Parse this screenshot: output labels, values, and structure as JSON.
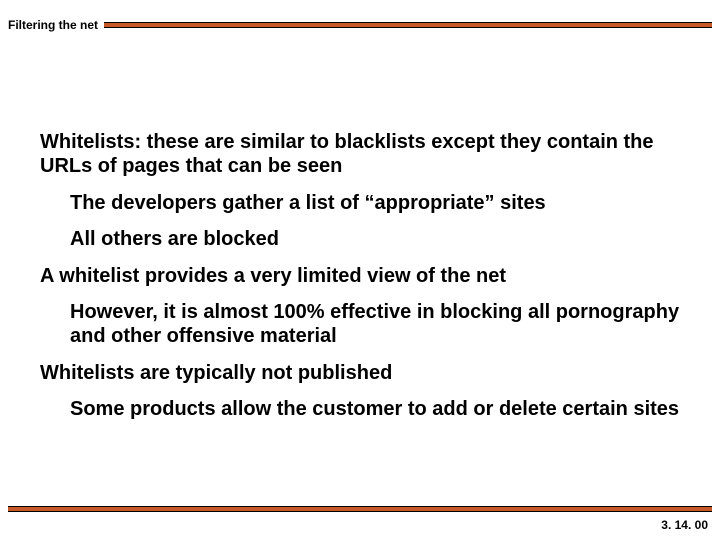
{
  "header": {
    "title": "Filtering the net"
  },
  "body": {
    "p1": "Whitelists: these are similar to blacklists except they contain the URLs of pages that can be seen",
    "p2": "The developers gather a list of “appropriate” sites",
    "p3": "All others are blocked",
    "p4": "A whitelist provides a very limited view of the net",
    "p5": "However, it is almost 100% effective in blocking all pornography and other offensive material",
    "p6": "Whitelists are typically not published",
    "p7": "Some products allow the customer to add or delete certain sites"
  },
  "footer": {
    "page": "3. 14. 00"
  }
}
